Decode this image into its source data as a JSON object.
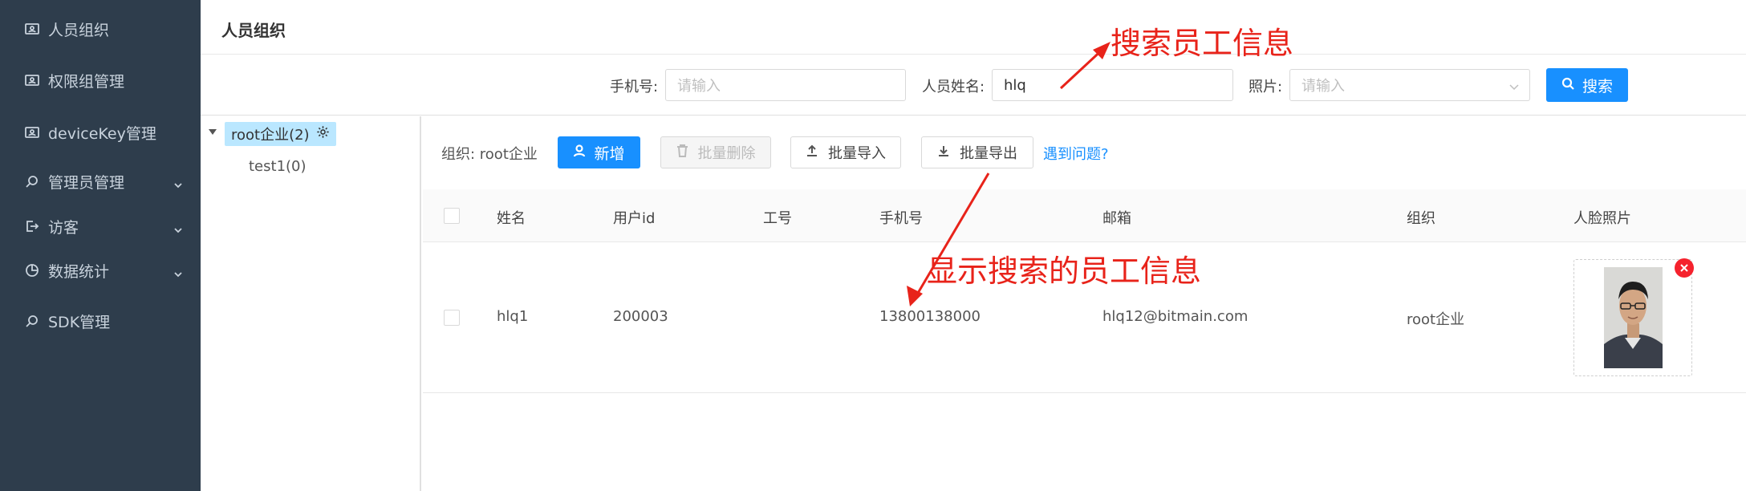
{
  "sidebar": {
    "items": [
      {
        "label": "人员组织",
        "icon": "id-card-icon",
        "has_submenu": false
      },
      {
        "label": "权限组管理",
        "icon": "id-card-icon",
        "has_submenu": false
      },
      {
        "label": "deviceKey管理",
        "icon": "id-card-icon",
        "has_submenu": false
      },
      {
        "label": "管理员管理",
        "icon": "search-icon",
        "has_submenu": true
      },
      {
        "label": "访客",
        "icon": "logout-icon",
        "has_submenu": true
      },
      {
        "label": "数据统计",
        "icon": "pie-chart-icon",
        "has_submenu": true
      },
      {
        "label": "SDK管理",
        "icon": "search-icon",
        "has_submenu": false
      }
    ]
  },
  "header": {
    "title": "人员组织"
  },
  "search": {
    "phone_label": "手机号:",
    "phone_placeholder": "请输入",
    "name_label": "人员姓名:",
    "name_value": "hlq",
    "photo_label": "照片:",
    "photo_placeholder": "请输入",
    "search_button": "搜索"
  },
  "tree": {
    "root_label": "root企业(2)",
    "children": [
      "test1(0)"
    ]
  },
  "toolbar": {
    "org_text": "组织: root企业",
    "add_button": "新增",
    "batch_delete_button": "批量删除",
    "batch_import_button": "批量导入",
    "batch_export_button": "批量导出",
    "help_link": "遇到问题?"
  },
  "table": {
    "columns": [
      "姓名",
      "用户id",
      "工号",
      "手机号",
      "邮箱",
      "组织",
      "人脸照片"
    ],
    "rows": [
      {
        "name": "hlq1",
        "user_id": "200003",
        "employee_no": "",
        "phone": "13800138000",
        "email": "hlq12@bitmain.com",
        "org": "root企业"
      }
    ]
  },
  "annotations": {
    "top": "搜索员工信息",
    "middle": "显示搜索的员工信息",
    "color": "#e8231a"
  },
  "colors": {
    "sidebar_bg": "#2e3d4c",
    "primary": "#1890ff",
    "tree_selected_bg": "#bae7ff"
  }
}
